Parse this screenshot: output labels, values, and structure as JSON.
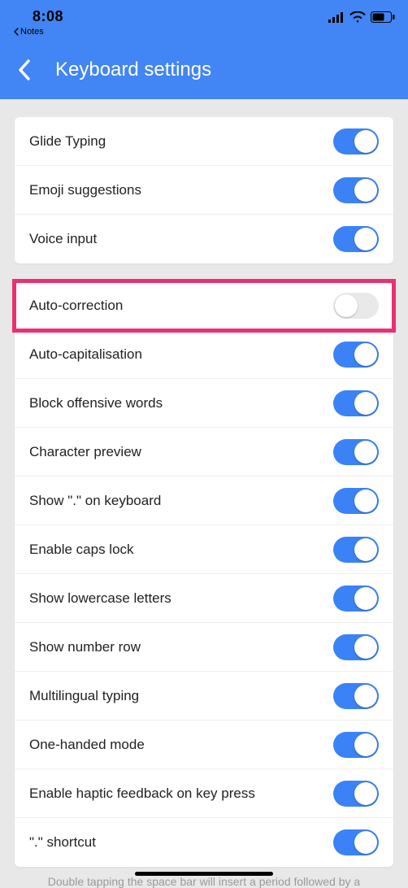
{
  "status": {
    "time": "8:08",
    "back_app_label": "Notes"
  },
  "header": {
    "title": "Keyboard settings"
  },
  "groups": [
    {
      "rows": [
        {
          "label": "Glide Typing",
          "on": true,
          "name": "glide-typing",
          "highlighted": false
        },
        {
          "label": "Emoji suggestions",
          "on": true,
          "name": "emoji-suggestions",
          "highlighted": false
        },
        {
          "label": "Voice input",
          "on": true,
          "name": "voice-input",
          "highlighted": false
        }
      ]
    },
    {
      "rows": [
        {
          "label": "Auto-correction",
          "on": false,
          "name": "auto-correction",
          "highlighted": true
        },
        {
          "label": "Auto-capitalisation",
          "on": true,
          "name": "auto-capitalisation",
          "highlighted": false
        },
        {
          "label": "Block offensive words",
          "on": true,
          "name": "block-offensive-words",
          "highlighted": false
        },
        {
          "label": "Character preview",
          "on": true,
          "name": "character-preview",
          "highlighted": false
        },
        {
          "label": "Show \".\" on keyboard",
          "on": true,
          "name": "show-period-on-keyboard",
          "highlighted": false
        },
        {
          "label": "Enable caps lock",
          "on": true,
          "name": "enable-caps-lock",
          "highlighted": false
        },
        {
          "label": "Show lowercase letters",
          "on": true,
          "name": "show-lowercase-letters",
          "highlighted": false
        },
        {
          "label": "Show number row",
          "on": true,
          "name": "show-number-row",
          "highlighted": false
        },
        {
          "label": "Multilingual typing",
          "on": true,
          "name": "multilingual-typing",
          "highlighted": false
        },
        {
          "label": "One-handed mode",
          "on": true,
          "name": "one-handed-mode",
          "highlighted": false
        },
        {
          "label": "Enable haptic feedback on key press",
          "on": true,
          "name": "enable-haptic-feedback",
          "highlighted": false
        },
        {
          "label": "\".\" shortcut",
          "on": true,
          "name": "period-shortcut",
          "highlighted": false
        }
      ]
    }
  ],
  "footer_text": "Double tapping the space bar will insert a period followed by a"
}
